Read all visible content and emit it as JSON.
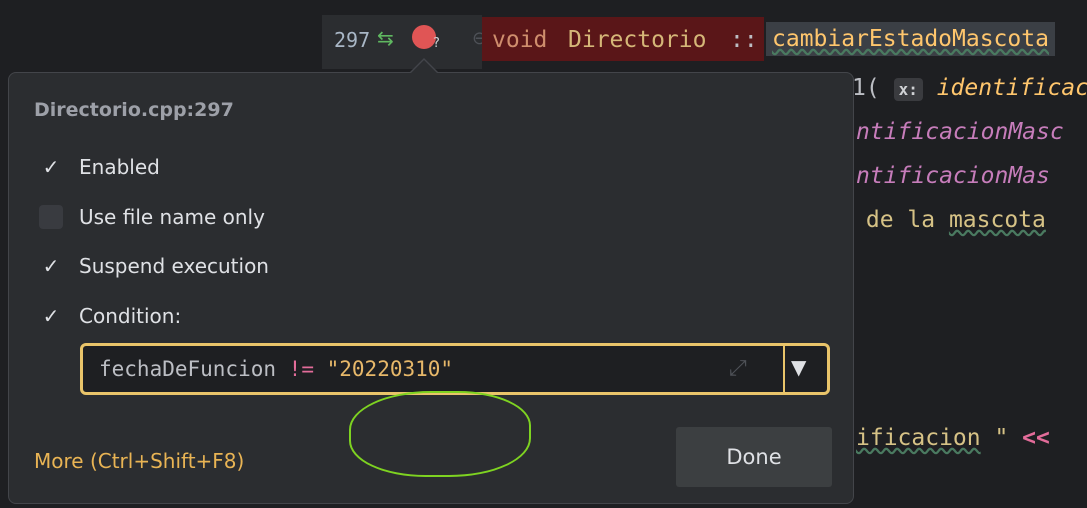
{
  "editor": {
    "line_number": "297",
    "vcs_icon": "arrows-left-right-icon",
    "breakpoint_icon": "conditional-breakpoint-icon",
    "breakpoint_hint": "?",
    "line_297": {
      "keyword": "void",
      "class_name": "Directorio",
      "separator": "::",
      "method": "cambiarEstadoMascota"
    },
    "snippets": {
      "line2_prefix": "1(",
      "line2_hint": "x:",
      "line2_italic": "identificac",
      "line3": "ntificacionMasc",
      "line4": "ntificacionMas",
      "line5_prefix": " de la ",
      "line5_underlined": "mascota",
      "line6_underlined": "ificacion",
      "line6_suffix": " \" ",
      "line6_op": "<<"
    }
  },
  "popup": {
    "title": "Directorio.cpp:297",
    "options": [
      {
        "label": "Enabled",
        "checked": true
      },
      {
        "label": "Use file name only",
        "checked": false
      },
      {
        "label": "Suspend execution",
        "checked": true
      },
      {
        "label": "Condition:",
        "checked": true
      }
    ],
    "condition": {
      "variable": "fechaDeFuncion",
      "operator": "!=",
      "string": "\"20220310\"",
      "expand_icon": "expand-icon",
      "dropdown_icon": "chevron-down-icon"
    },
    "more_link": "More (Ctrl+Shift+F8)",
    "done_button": "Done"
  },
  "colors": {
    "accent_focus": "#e9c46a",
    "annotation": "#7ed321",
    "breakpoint": "#e05555"
  }
}
